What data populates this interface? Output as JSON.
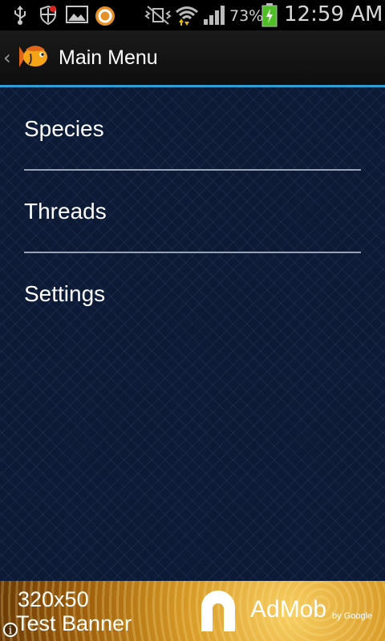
{
  "status_bar": {
    "icons": [
      "usb-icon",
      "shield-icon",
      "picture-icon",
      "cyanogen-icon",
      "mute-icon",
      "wifi-icon",
      "signal-icon",
      "battery-charging-icon"
    ],
    "battery_percent": "73%",
    "time": "12:59 AM"
  },
  "action_bar": {
    "title": "Main Menu",
    "back_glyph": "‹",
    "accent_color": "#2f9ed6"
  },
  "menu": {
    "items": [
      {
        "label": "Species"
      },
      {
        "label": "Threads"
      },
      {
        "label": "Settings"
      }
    ]
  },
  "ad": {
    "line1": "320x50",
    "line2": "Test Banner",
    "brand": "AdMob",
    "by": "by Google",
    "info_glyph": "i"
  }
}
